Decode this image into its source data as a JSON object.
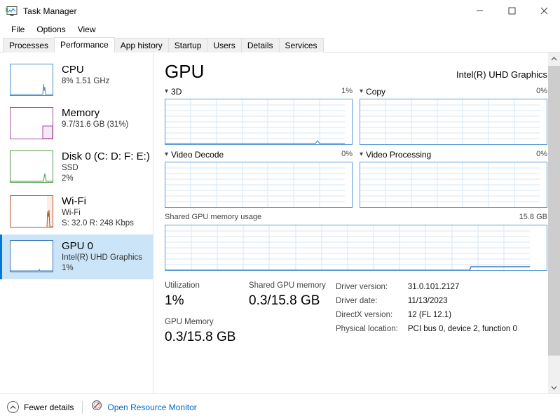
{
  "window": {
    "title": "Task Manager",
    "icon": "task-manager-icon",
    "controls": {
      "minimize": "–",
      "maximize": "☐",
      "close": "×"
    }
  },
  "menu": {
    "items": [
      "File",
      "Options",
      "View"
    ]
  },
  "tabs": {
    "active": "Performance",
    "items": [
      "Processes",
      "Performance",
      "App history",
      "Startup",
      "Users",
      "Details",
      "Services"
    ]
  },
  "sidebar": {
    "items": [
      {
        "name": "cpu",
        "title": "CPU",
        "sub1": "8% 1.51 GHz",
        "sub2": "",
        "color": "#4a90c4",
        "selected": false
      },
      {
        "name": "memory",
        "title": "Memory",
        "sub1": "9.7/31.6 GB (31%)",
        "sub2": "",
        "color": "#a34da3",
        "selected": false
      },
      {
        "name": "disk",
        "title": "Disk 0 (C: D: F: E:)",
        "sub1": "SSD",
        "sub2": "2%",
        "color": "#4f9a4f",
        "selected": false
      },
      {
        "name": "wifi",
        "title": "Wi-Fi",
        "sub1": "Wi-Fi",
        "sub2": "S: 32.0 R: 248 Kbps",
        "color": "#b5532a",
        "selected": false
      },
      {
        "name": "gpu",
        "title": "GPU 0",
        "sub1": "Intel(R) UHD Graphics",
        "sub2": "1%",
        "color": "#3b78b5",
        "selected": true
      }
    ]
  },
  "main": {
    "title": "GPU",
    "device": "Intel(R) UHD Graphics",
    "engines": [
      {
        "label": "3D",
        "value": "1%"
      },
      {
        "label": "Copy",
        "value": "0%"
      },
      {
        "label": "Video Decode",
        "value": "0%"
      },
      {
        "label": "Video Processing",
        "value": "0%"
      }
    ],
    "shared_graph": {
      "label": "Shared GPU memory usage",
      "max": "15.8 GB"
    },
    "stats": {
      "utilization_label": "Utilization",
      "utilization_value": "1%",
      "gpu_memory_label": "GPU Memory",
      "gpu_memory_value": "0.3/15.8 GB",
      "shared_memory_label": "Shared GPU memory",
      "shared_memory_value": "0.3/15.8 GB"
    },
    "info": [
      {
        "key": "Driver version:",
        "val": "31.0.101.2127"
      },
      {
        "key": "Driver date:",
        "val": "11/13/2023"
      },
      {
        "key": "DirectX version:",
        "val": "12 (FL 12.1)"
      },
      {
        "key": "Physical location:",
        "val": "PCI bus 0, device 2, function 0"
      }
    ]
  },
  "footer": {
    "fewer_details": "Fewer details",
    "resource_monitor": "Open Resource Monitor"
  },
  "colors": {
    "accent": "#0078d7",
    "selection": "#cce4f7",
    "graph_border": "#5b9bd5",
    "link": "#0066cc"
  }
}
